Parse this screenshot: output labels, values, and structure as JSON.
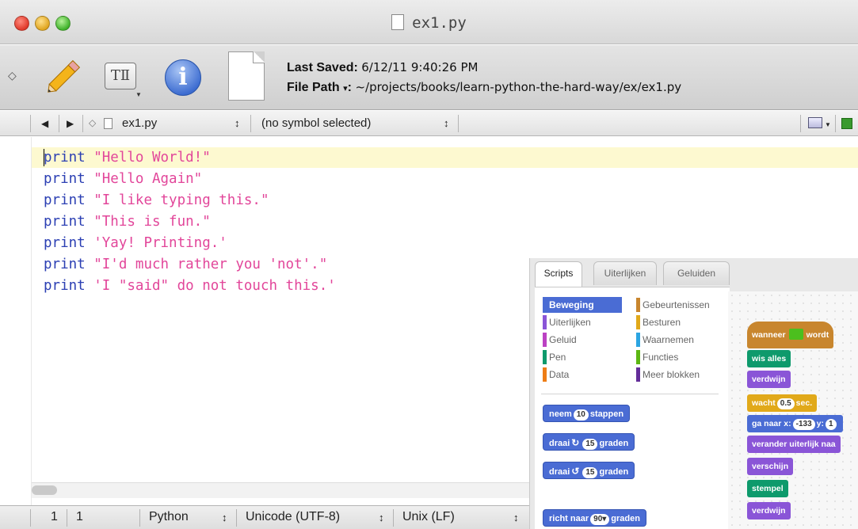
{
  "window": {
    "title": "ex1.py"
  },
  "toolbar": {
    "tmark_label": "TⅡ",
    "info_glyph": "i",
    "last_saved_label": "Last Saved:",
    "last_saved_value": "6/12/11 9:40:26 PM",
    "file_path_label": "File Path",
    "file_path_caret": "▾",
    "file_path_colon": ":",
    "file_path_value": "~/projects/books/learn-python-the-hard-way/ex/ex1.py"
  },
  "navbar": {
    "back_glyph": "◀",
    "forward_glyph": "▶",
    "marker_glyph": "◇",
    "file_name": "ex1.py",
    "file_caret": "↕",
    "symbol": "(no symbol selected)",
    "symbol_caret": "↕"
  },
  "editor": {
    "lines": [
      {
        "kw": "print",
        "str": " \"Hello World!\""
      },
      {
        "kw": "print",
        "str": " \"Hello Again\""
      },
      {
        "kw": "print",
        "str": " \"I like typing this.\""
      },
      {
        "kw": "print",
        "str": " \"This is fun.\""
      },
      {
        "kw": "print",
        "str": " 'Yay! Printing.'"
      },
      {
        "kw": "print",
        "str": " \"I'd much rather you 'not'.\""
      },
      {
        "kw": "print",
        "str": " 'I \"said\" do not touch this.'"
      }
    ]
  },
  "statusbar": {
    "line": "1",
    "column": "1",
    "language": "Python",
    "encoding": "Unicode (UTF-8)",
    "line_endings": "Unix (LF)",
    "updown": "↕"
  },
  "scratch": {
    "tabs": [
      "Scripts",
      "Uiterlijken",
      "Geluiden"
    ],
    "categories": [
      {
        "label": "Beweging",
        "color": "#4a6cd4"
      },
      {
        "label": "Uiterlijken",
        "color": "#8a55d7"
      },
      {
        "label": "Geluid",
        "color": "#bb42c3"
      },
      {
        "label": "Pen",
        "color": "#0e9a6c"
      },
      {
        "label": "Data",
        "color": "#ee7d16"
      },
      {
        "label": "Gebeurtenissen",
        "color": "#c8862e"
      },
      {
        "label": "Besturen",
        "color": "#e1a91a"
      },
      {
        "label": "Waarnemen",
        "color": "#2ca5e2"
      },
      {
        "label": "Functies",
        "color": "#5cb712"
      },
      {
        "label": "Meer blokken",
        "color": "#632d99"
      }
    ],
    "palette_blocks": {
      "move": {
        "pre": "neem",
        "val": "10",
        "post": "stappen"
      },
      "turn_right": {
        "pre": "draai",
        "icon": "↻",
        "val": "15",
        "post": "graden"
      },
      "turn_left": {
        "pre": "draai",
        "icon": "↺",
        "val": "15",
        "post": "graden"
      },
      "point": {
        "pre": "richt naar",
        "val": "90▾",
        "post": "graden"
      }
    },
    "script": {
      "when_flag": {
        "pre": "wanneer",
        "post": "wordt"
      },
      "clear": "wis alles",
      "hide": "verdwijn",
      "wait": {
        "pre": "wacht",
        "val": "0.5",
        "post": "sec."
      },
      "goto": {
        "pre": "ga naar x:",
        "x": "-133",
        "ylabel": "y:",
        "y": "1"
      },
      "switch_costume": "verander uiterlijk naa",
      "show": "verschijn",
      "stamp": "stempel",
      "hide2": "verdwijn"
    }
  }
}
